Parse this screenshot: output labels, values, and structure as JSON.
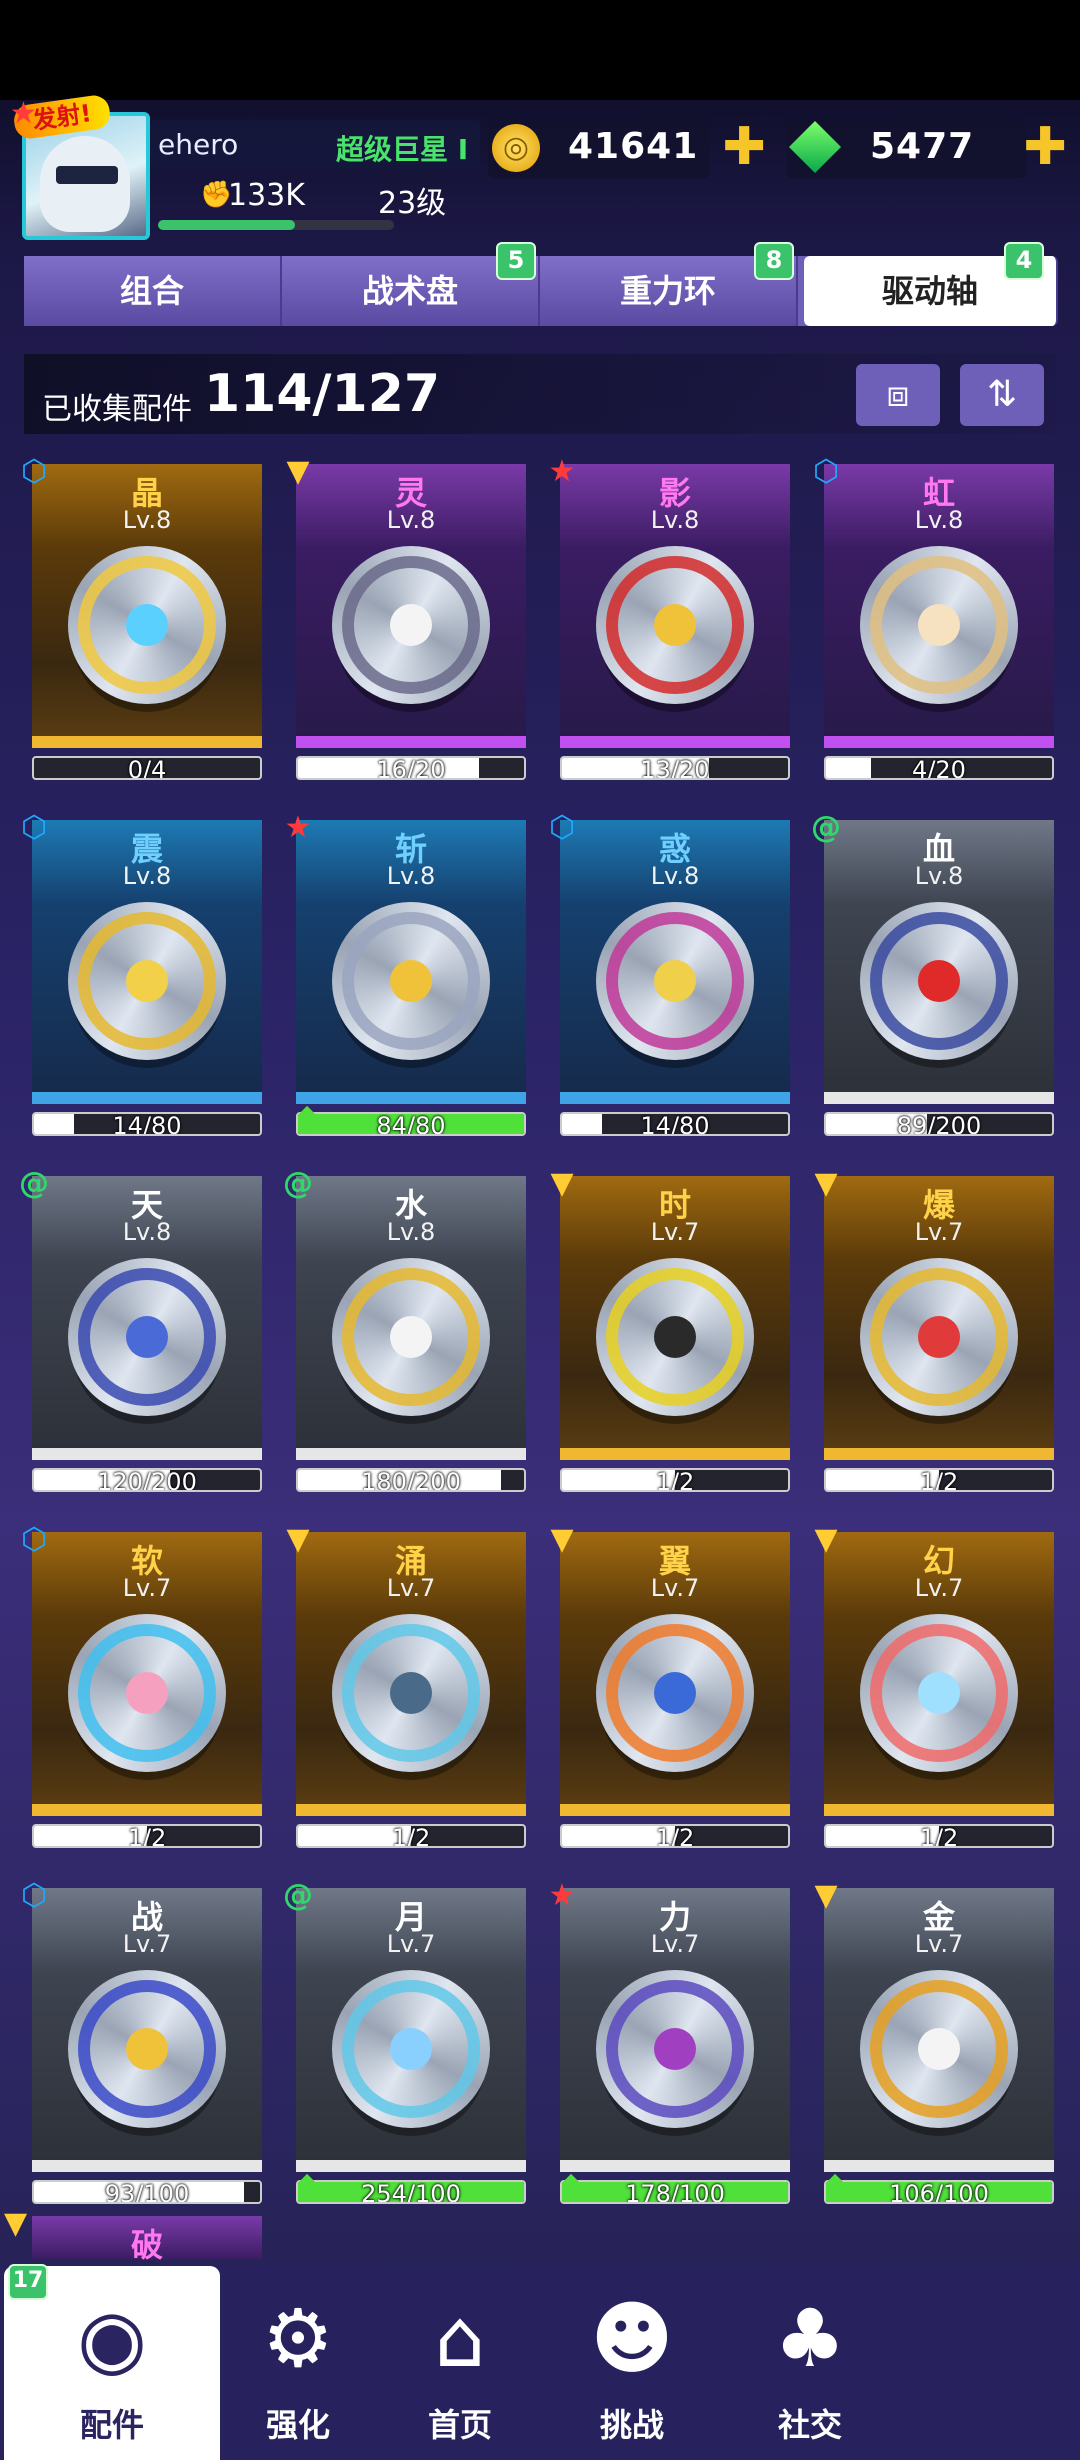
{
  "player": {
    "name": "ehero",
    "title": "超级巨星 I",
    "power": "133K",
    "level": "23级",
    "avatar_badge": "发射!",
    "xp_fraction": 0.58
  },
  "currency": {
    "coins": "41641",
    "gems": "5477",
    "coin_icon": "coin-icon",
    "gem_icon": "gem-icon",
    "plus_icon": "plus-icon"
  },
  "tabs": [
    {
      "label": "组合",
      "badge": ""
    },
    {
      "label": "战术盘",
      "badge": "5"
    },
    {
      "label": "重力环",
      "badge": "8"
    },
    {
      "label": "驱动轴",
      "badge": "4"
    }
  ],
  "active_tab": 3,
  "collection": {
    "label": "已收集配件",
    "value": "114/127",
    "filter_icon": "filter-icon",
    "sort_icon": "sort-icon"
  },
  "cards": [
    {
      "name": "晶",
      "level": "Lv.8",
      "progress": "0/4",
      "fill": 0.0,
      "rarity": "gold",
      "type": "blue",
      "type_icon": "hexagon-gear-icon",
      "upgrade": false,
      "core": "#5ad0ff",
      "ring": "#f0c840"
    },
    {
      "name": "灵",
      "level": "Lv.8",
      "progress": "16/20",
      "fill": 0.8,
      "rarity": "purple",
      "type": "gold",
      "type_icon": "chevron-badge-icon",
      "upgrade": false,
      "core": "#f4f4f4",
      "ring": "#6a6a8a"
    },
    {
      "name": "影",
      "level": "Lv.8",
      "progress": "13/20",
      "fill": 0.65,
      "rarity": "purple",
      "type": "red",
      "type_icon": "star-badge-icon",
      "upgrade": false,
      "core": "#f0c23a",
      "ring": "#d42a2a"
    },
    {
      "name": "虹",
      "level": "Lv.8",
      "progress": "4/20",
      "fill": 0.2,
      "rarity": "purple",
      "type": "blue",
      "type_icon": "hexagon-gear-icon",
      "upgrade": false,
      "core": "#f6e2c0",
      "ring": "#e0c080"
    },
    {
      "name": "震",
      "level": "Lv.8",
      "progress": "14/80",
      "fill": 0.175,
      "rarity": "blue",
      "type": "blue",
      "type_icon": "hexagon-gear-icon",
      "upgrade": false,
      "core": "#f2d04a",
      "ring": "#e6b82e"
    },
    {
      "name": "斩",
      "level": "Lv.8",
      "progress": "84/80",
      "fill": 1.0,
      "rarity": "blue",
      "type": "red",
      "type_icon": "star-badge-icon",
      "upgrade": true,
      "core": "#f0c23a",
      "ring": "#9aa4c0"
    },
    {
      "name": "惑",
      "level": "Lv.8",
      "progress": "14/80",
      "fill": 0.175,
      "rarity": "blue",
      "type": "blue",
      "type_icon": "hexagon-gear-icon",
      "upgrade": false,
      "core": "#f0d04a",
      "ring": "#c03a9a"
    },
    {
      "name": "血",
      "level": "Lv.8",
      "progress": "89/200",
      "fill": 0.445,
      "rarity": "gray",
      "type": "green",
      "type_icon": "swirl-badge-icon",
      "upgrade": false,
      "core": "#e02a2a",
      "ring": "#3a4aa0"
    },
    {
      "name": "天",
      "level": "Lv.8",
      "progress": "120/200",
      "fill": 0.6,
      "rarity": "gray",
      "type": "green",
      "type_icon": "swirl-badge-icon",
      "upgrade": false,
      "core": "#4a6ad8",
      "ring": "#3a4ab0"
    },
    {
      "name": "水",
      "level": "Lv.8",
      "progress": "180/200",
      "fill": 0.9,
      "rarity": "gray",
      "type": "green",
      "type_icon": "swirl-badge-icon",
      "upgrade": false,
      "core": "#f4f4f4",
      "ring": "#e6b82e"
    },
    {
      "name": "时",
      "level": "Lv.7",
      "progress": "1/2",
      "fill": 0.5,
      "rarity": "gold",
      "type": "gold",
      "type_icon": "chevron-badge-icon",
      "upgrade": false,
      "core": "#2a2a2a",
      "ring": "#e6d020"
    },
    {
      "name": "爆",
      "level": "Lv.7",
      "progress": "1/2",
      "fill": 0.5,
      "rarity": "gold",
      "type": "gold",
      "type_icon": "chevron-badge-icon",
      "upgrade": false,
      "core": "#e03a3a",
      "ring": "#e6b82e"
    },
    {
      "name": "软",
      "level": "Lv.7",
      "progress": "1/2",
      "fill": 0.5,
      "rarity": "gold",
      "type": "blue",
      "type_icon": "hexagon-gear-icon",
      "upgrade": false,
      "core": "#f6a0c0",
      "ring": "#40c0f0"
    },
    {
      "name": "涌",
      "level": "Lv.7",
      "progress": "1/2",
      "fill": 0.5,
      "rarity": "gold",
      "type": "gold",
      "type_icon": "chevron-badge-icon",
      "upgrade": false,
      "core": "#4a6a8a",
      "ring": "#60c8e8"
    },
    {
      "name": "翼",
      "level": "Lv.7",
      "progress": "1/2",
      "fill": 0.5,
      "rarity": "gold",
      "type": "gold",
      "type_icon": "chevron-badge-icon",
      "upgrade": false,
      "core": "#3a6ad8",
      "ring": "#f07a2a"
    },
    {
      "name": "幻",
      "level": "Lv.7",
      "progress": "1/2",
      "fill": 0.5,
      "rarity": "gold",
      "type": "gold",
      "type_icon": "chevron-badge-icon",
      "upgrade": false,
      "core": "#a0e0ff",
      "ring": "#f06a6a"
    },
    {
      "name": "战",
      "level": "Lv.7",
      "progress": "93/100",
      "fill": 0.93,
      "rarity": "gray",
      "type": "blue",
      "type_icon": "hexagon-gear-icon",
      "upgrade": false,
      "core": "#f0c23a",
      "ring": "#3a4ac8"
    },
    {
      "name": "月",
      "level": "Lv.7",
      "progress": "254/100",
      "fill": 1.0,
      "rarity": "gray",
      "type": "green",
      "type_icon": "swirl-badge-icon",
      "upgrade": true,
      "core": "#8ad0ff",
      "ring": "#60c8e8"
    },
    {
      "name": "力",
      "level": "Lv.7",
      "progress": "178/100",
      "fill": 1.0,
      "rarity": "gray",
      "type": "red",
      "type_icon": "star-badge-icon",
      "upgrade": true,
      "core": "#a040c0",
      "ring": "#5a4ac0"
    },
    {
      "name": "金",
      "level": "Lv.7",
      "progress": "106/100",
      "fill": 1.0,
      "rarity": "gray",
      "type": "gold",
      "type_icon": "chevron-badge-icon",
      "upgrade": true,
      "core": "#f4f4f4",
      "ring": "#e6a020"
    }
  ],
  "partial_card": {
    "name": "破",
    "type_icon": "chevron-badge-icon"
  },
  "nav": {
    "badge": "17",
    "items": [
      {
        "label": "配件",
        "icon": "parts-icon",
        "active": true
      },
      {
        "label": "强化",
        "icon": "enhance-icon",
        "active": false
      },
      {
        "label": "首页",
        "icon": "home-icon",
        "active": false
      },
      {
        "label": "挑战",
        "icon": "challenge-icon",
        "active": false
      },
      {
        "label": "社交",
        "icon": "social-icon",
        "active": false
      }
    ]
  },
  "colors": {
    "accent": "#6e5fb8",
    "upgrade_green": "#4fe03a",
    "gold": "#f6c52a"
  }
}
